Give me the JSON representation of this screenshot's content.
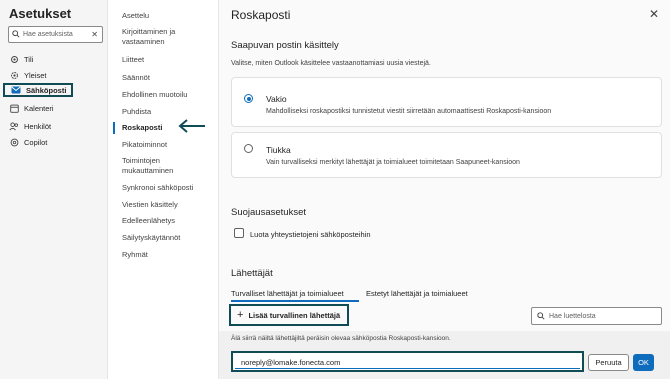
{
  "nav": {
    "title": "Asetukset",
    "search_placeholder": "Hae asetuksista",
    "items": [
      {
        "label": "Tili",
        "icon": "gear-icon"
      },
      {
        "label": "Yleiset",
        "icon": "gear-icon"
      },
      {
        "label": "Sähköposti",
        "icon": "mail-icon"
      },
      {
        "label": "Kalenteri",
        "icon": "calendar-icon"
      },
      {
        "label": "Henkilöt",
        "icon": "people-icon"
      },
      {
        "label": "Copilot",
        "icon": "copilot-icon"
      }
    ]
  },
  "mid": {
    "items": [
      "Asettelu",
      "Kirjoittaminen ja",
      "vastaaminen",
      "Liitteet",
      "Säännöt",
      "Ehdollinen muotoilu",
      "Puhdista",
      "Roskaposti",
      "Pikatoiminnot",
      "Toimintojen",
      "mukauttaminen",
      "Synkronoi sähköposti",
      "Viestien käsittely",
      "Edelleenlähetys",
      "Säilytyskäytännöt",
      "Ryhmät"
    ]
  },
  "main": {
    "title": "Roskaposti",
    "incoming": {
      "heading": "Saapuvan postin käsittely",
      "sub": "Valitse, miten Outlook käsittelee vastaanottamiasi uusia viestejä.",
      "options": [
        {
          "title": "Vakio",
          "desc": "Mahdolliseksi roskapostiksi tunnistetut viestit siirretään automaattisesti Roskaposti-kansioon",
          "selected": true
        },
        {
          "title": "Tiukka",
          "desc": "Vain turvalliseksi merkityt lähettäjät ja toimialueet toimitetaan Saapuneet-kansioon",
          "selected": false
        }
      ]
    },
    "security": {
      "heading": "Suojausasetukset",
      "checkbox_label": "Luota yhteystietojeni sähköposteihin",
      "checked": false
    },
    "senders": {
      "heading": "Lähettäjät",
      "tab_safe": "Turvalliset lähettäjät ja toimialueet",
      "tab_blocked": "Estetyt lähettäjät ja toimialueet",
      "add_label": "Lisää turvallinen lähettäjä",
      "filter_placeholder": "Hae luettelosta",
      "notice": "Älä siirrä näiltä lähettäjiltä peräisin olevaa sähköpostia Roskaposti-kansioon.",
      "email_value": "noreply@lomake.fonecta.com",
      "cancel_label": "Peruuta",
      "ok_label": "OK"
    }
  },
  "colors": {
    "accent": "#0f6cbd",
    "highlight": "#0f4c55"
  }
}
